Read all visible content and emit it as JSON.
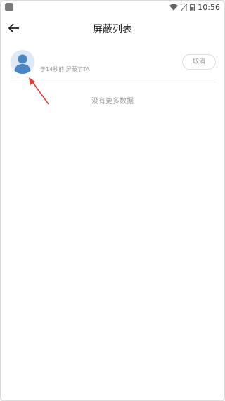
{
  "status_bar": {
    "time": "10:56"
  },
  "header": {
    "title": "屏蔽列表",
    "back_icon": "arrow-left-icon"
  },
  "blocked_list": {
    "items": [
      {
        "avatar_icon": "default-user-avatar-icon",
        "meta": "于14秒前 屏蔽了TA",
        "action_label": "取消"
      }
    ],
    "footer_text": "没有更多数据"
  },
  "colors": {
    "annotation_arrow": "#e53935",
    "avatar_bg": "#dde9f7",
    "avatar_figure": "#4a86c5"
  }
}
